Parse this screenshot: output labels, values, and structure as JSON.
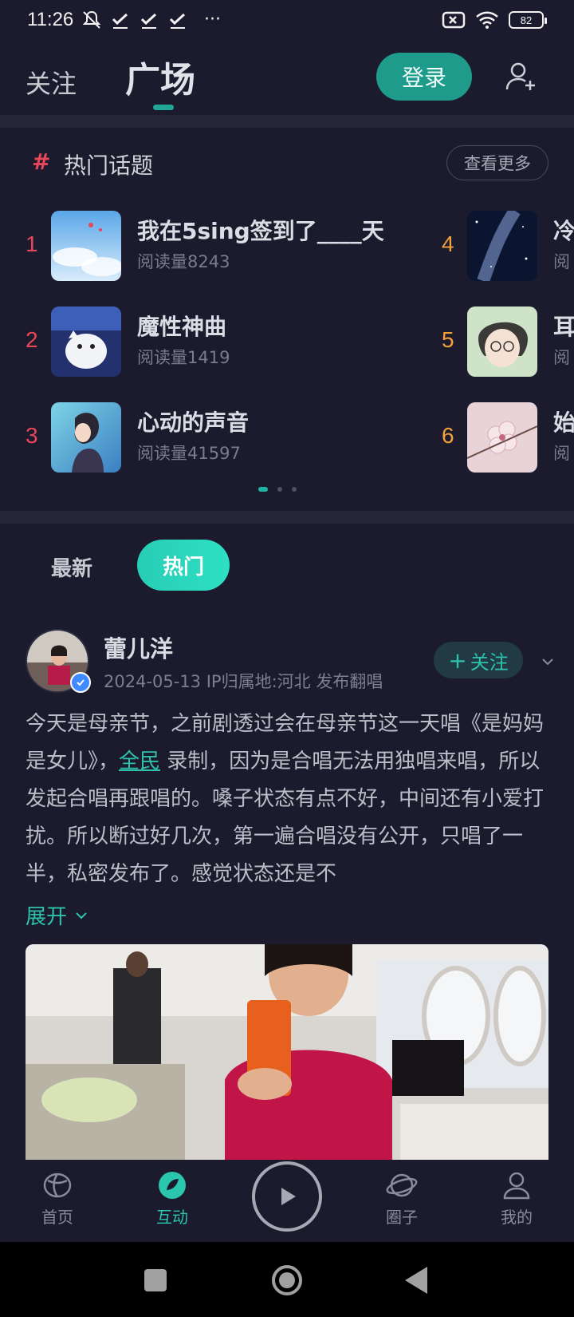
{
  "status_bar": {
    "time": "11:26",
    "more": "···",
    "battery": "82",
    "icons": [
      "notification-off-icon",
      "check-icon",
      "check-icon",
      "check-icon",
      "sim-off-icon",
      "wifi-icon",
      "battery-icon"
    ]
  },
  "top_nav": {
    "tab_follow": "关注",
    "tab_square": "广场",
    "login_label": "登录",
    "accent_color": "#20a597"
  },
  "hot_topics": {
    "hash": "#",
    "title": "热门话题",
    "more_label": "查看更多",
    "items": [
      {
        "rank": "1",
        "name": "我在5sing签到了____天",
        "reads": "阅读量8243"
      },
      {
        "rank": "2",
        "name": "魔性神曲",
        "reads": "阅读量1419"
      },
      {
        "rank": "3",
        "name": "心动的声音",
        "reads": "阅读量41597"
      },
      {
        "rank": "4",
        "name": "冷",
        "reads": "阅"
      },
      {
        "rank": "5",
        "name": "耳",
        "reads": "阅"
      },
      {
        "rank": "6",
        "name": "始",
        "reads": "阅"
      }
    ],
    "page_count": 3,
    "active_page": 0
  },
  "feed_tabs": {
    "latest": "最新",
    "hot": "热门"
  },
  "post": {
    "username": "蕾儿洋",
    "meta": "2024-05-13 IP归属地:河北 发布翻唱",
    "follow_label": "关注",
    "follow_plus": "+",
    "text_before": "今天是母亲节，之前剧透过会在母亲节这一天唱《是妈妈是女儿》，",
    "link": "全民",
    "text_after": " 录制，因为是合唱无法用独唱来唱，所以发起合唱再跟唱的。嗓子状态有点不好，中间还有小爱打扰。所以断过好几次，第一遍合唱没有公开，只唱了一半，私密发布了。感觉状态还是不",
    "expand_label": "展开"
  },
  "bottom_nav": {
    "home": "首页",
    "interact": "互动",
    "circle": "圈子",
    "mine": "我的",
    "active_color": "#2ac6ae"
  }
}
